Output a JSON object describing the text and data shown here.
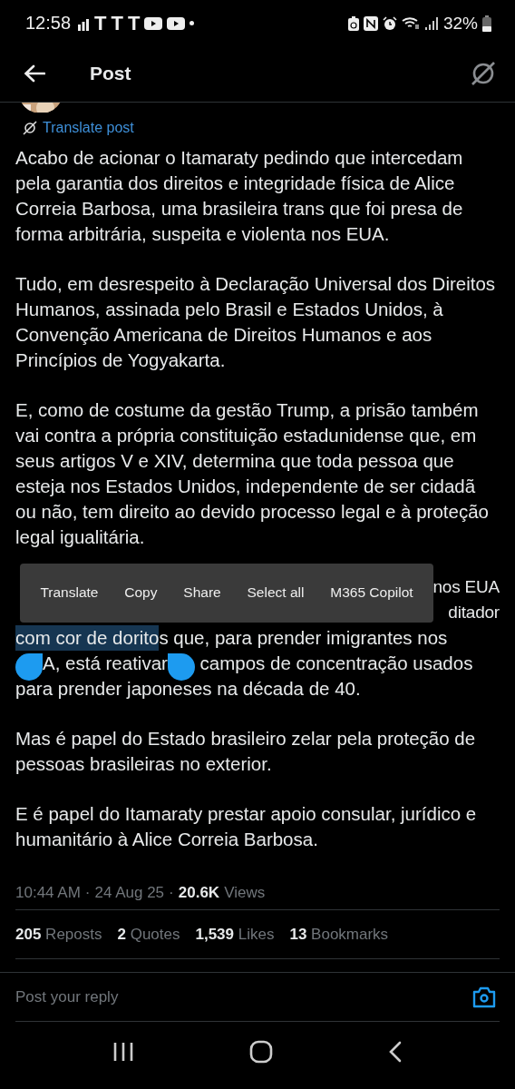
{
  "status_bar": {
    "time": "12:58",
    "app_letters": [
      "T",
      "T",
      "T"
    ],
    "battery": "32%"
  },
  "header": {
    "title": "Post"
  },
  "translate_link": "Translate post",
  "paragraphs": [
    "Acabo de acionar o Itamaraty pedindo que intercedam pela garantia dos direitos e integridade física de Alice Correia Barbosa, uma brasileira trans que foi presa de forma arbitrária, suspeita e violenta nos EUA.",
    "Tudo, em desrespeito à Declaração Universal dos Direitos Humanos, assinada pelo Brasil e Estados Unidos, à Convenção Americana de Direitos Humanos e aos Princípios de Yogyakarta.",
    "E, como de costume da gestão Trump, a prisão também vai contra a própria constituição estadunidense que, em seus artigos V e XIV, determina que toda pessoa que esteja nos Estados Unidos, independente de ser cidadã ou não, tem direito ao devido processo legal e à proteção legal igualitária."
  ],
  "covered_paragraph": {
    "line_1": {
      "end": "nos EUA"
    },
    "line_2": {
      "end": "ditador"
    },
    "line_3": {
      "selected": "com cor de dorito",
      "rest": "s que, para prender imigrantes nos"
    },
    "line_4": {
      "middle": "A, está reativar",
      "rest": " campos de concentração usados"
    },
    "line_5": "para prender japoneses na década de 40."
  },
  "context_menu": [
    "Translate",
    "Copy",
    "Share",
    "Select all",
    "M365 Copilot"
  ],
  "paragraphs_after": [
    "Mas é papel do Estado brasileiro zelar pela proteção de pessoas brasileiras no exterior.",
    "E é papel do Itamaraty prestar apoio consular, jurídico e humanitário à Alice Correia Barbosa."
  ],
  "meta": {
    "time": "10:44 AM",
    "separator_1": "·",
    "date": "24 Aug 25",
    "separator_2": "·",
    "views_count": "20.6K",
    "views_label": "Views"
  },
  "stats": [
    {
      "count": "205",
      "label": "Reposts"
    },
    {
      "count": "2",
      "label": "Quotes"
    },
    {
      "count": "1,539",
      "label": "Likes"
    },
    {
      "count": "13",
      "label": "Bookmarks"
    }
  ],
  "reply": {
    "placeholder": "Post your reply"
  }
}
